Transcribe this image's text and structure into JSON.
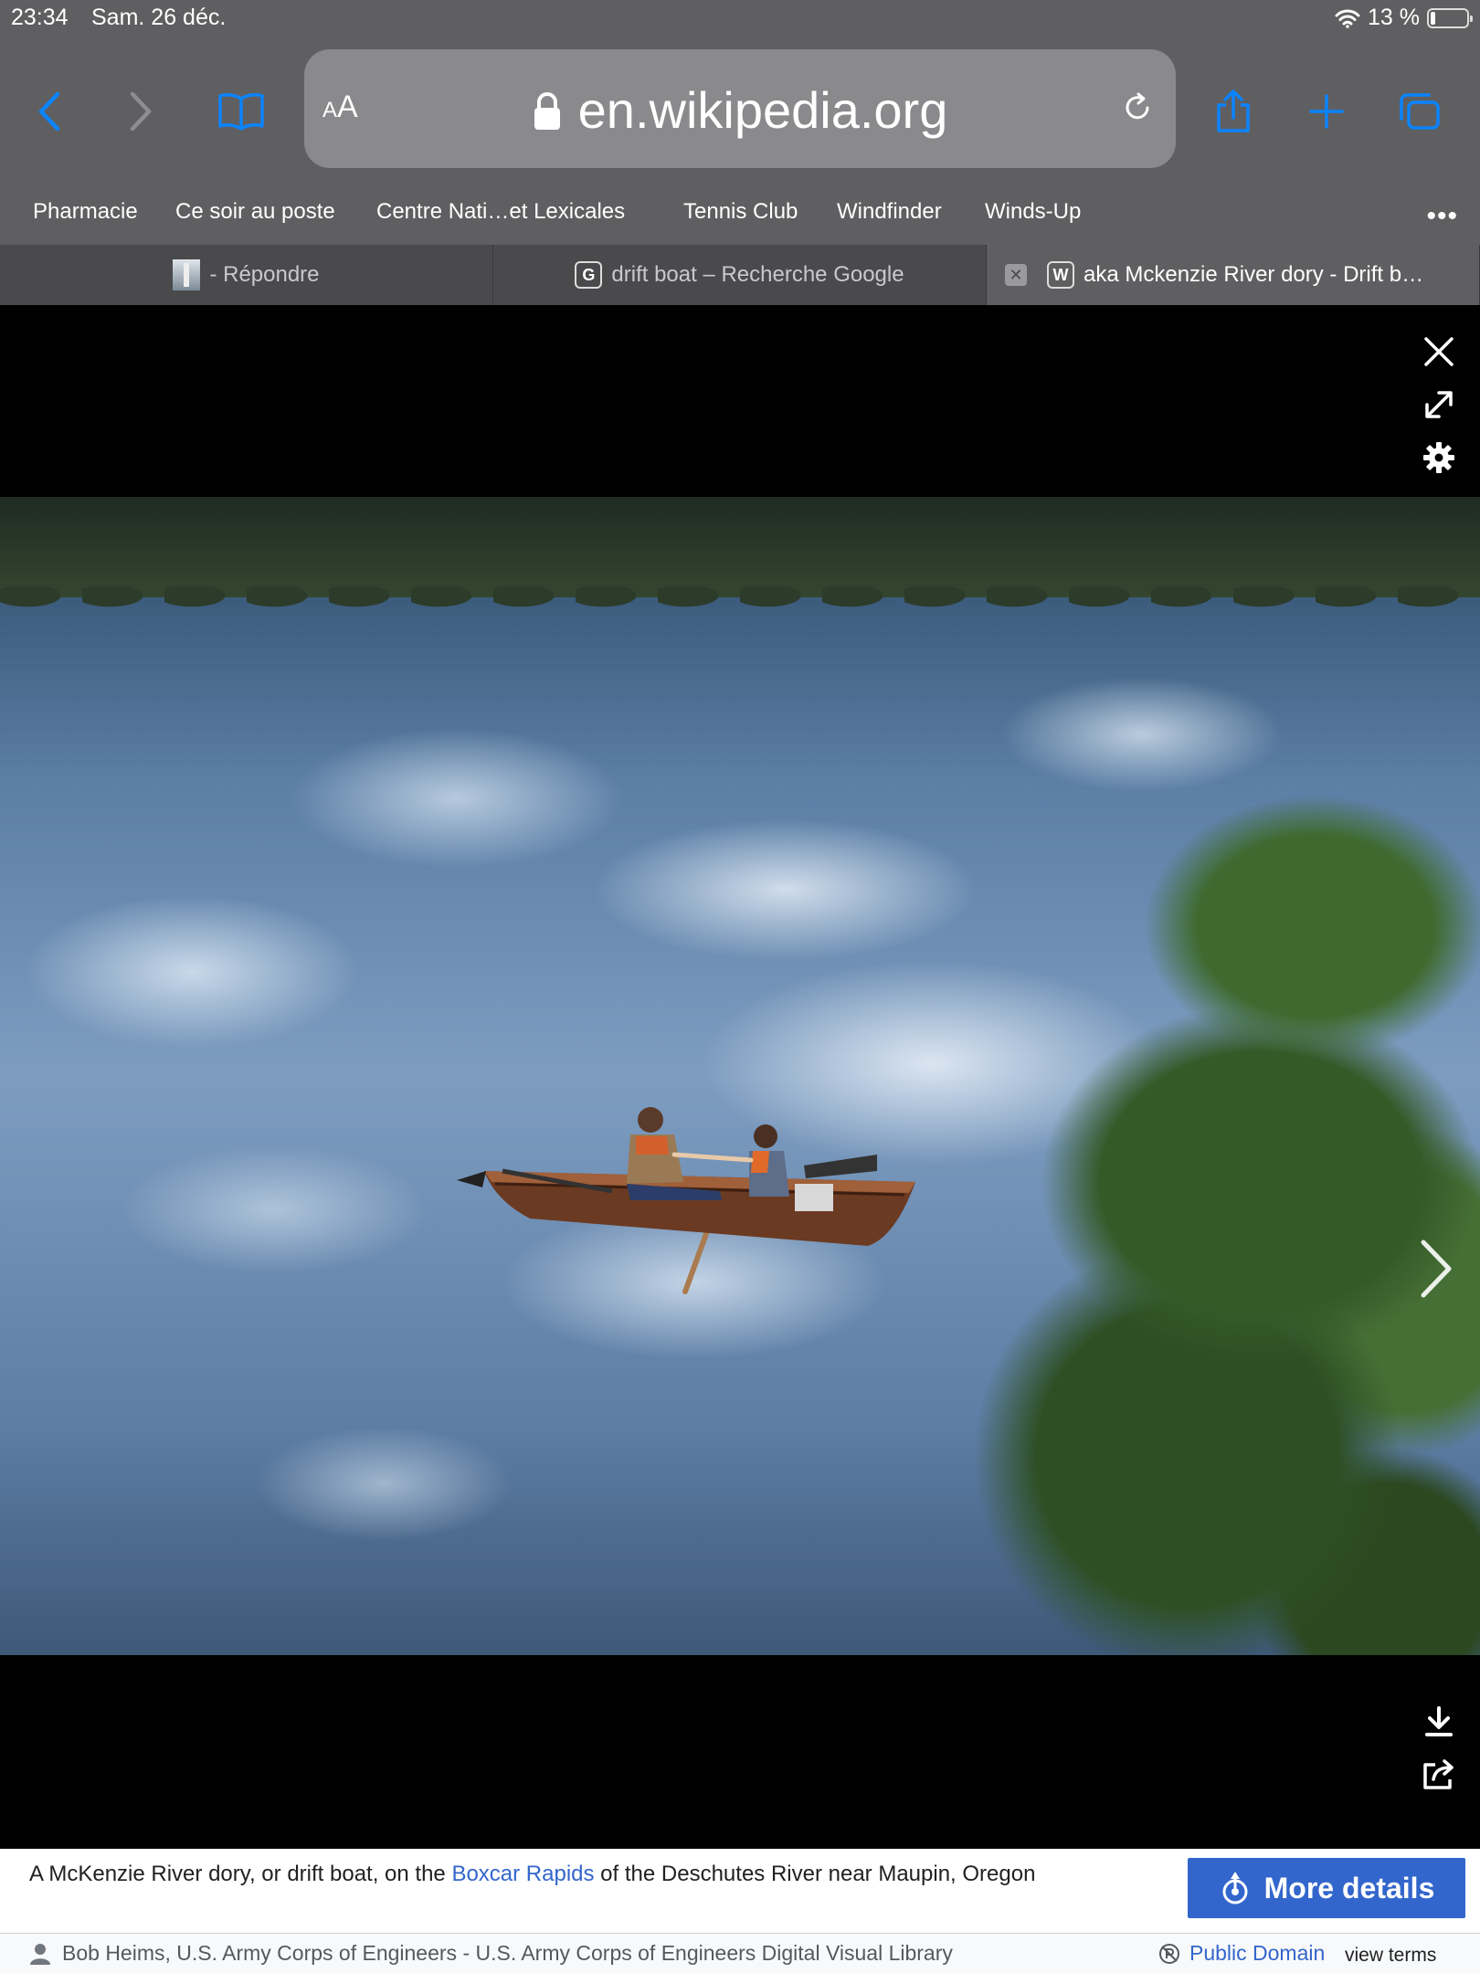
{
  "status_bar": {
    "time": "23:34",
    "date": "Sam. 26 déc.",
    "battery_text": "13 %",
    "battery_level": 0.13
  },
  "toolbar": {
    "back_icon": "chevron-left-icon",
    "forward_icon": "chevron-right-icon",
    "bookmarks_icon": "book-icon",
    "reader_label": "AA",
    "url": "en.wikipedia.org",
    "share_icon": "share-icon",
    "new_tab_icon": "plus-icon",
    "tabs_icon": "tabs-overview-icon"
  },
  "bookmarks": [
    "Pharmacie",
    "Ce soir au poste",
    "Centre Nati…et Lexicales",
    "Tennis Club",
    "Windfinder",
    "Winds-Up"
  ],
  "tabs": [
    {
      "title": "- Répondre",
      "favicon": "thumbnail"
    },
    {
      "title": "drift boat – Recherche Google",
      "favicon": "G"
    },
    {
      "title": "aka Mckenzie River dory - Drift b…",
      "favicon": "W",
      "active": true
    }
  ],
  "viewer": {
    "image_alt": "McKenzie River dory drifting through rapids",
    "caption_prefix": "A McKenzie River dory, or drift boat, on the ",
    "caption_link": "Boxcar Rapids",
    "caption_suffix": " of the Deschutes River near Maupin, Oregon",
    "more_details_label": "More details",
    "credit": "Bob Heims, U.S. Army Corps of Engineers - U.S. Army Corps of Engineers Digital Visual Library",
    "license": "Public Domain",
    "view_terms": "view terms"
  },
  "colors": {
    "chrome_bg": "#5f5f61",
    "accent_blue": "#3366cc",
    "safari_blue": "#0a84ff"
  }
}
